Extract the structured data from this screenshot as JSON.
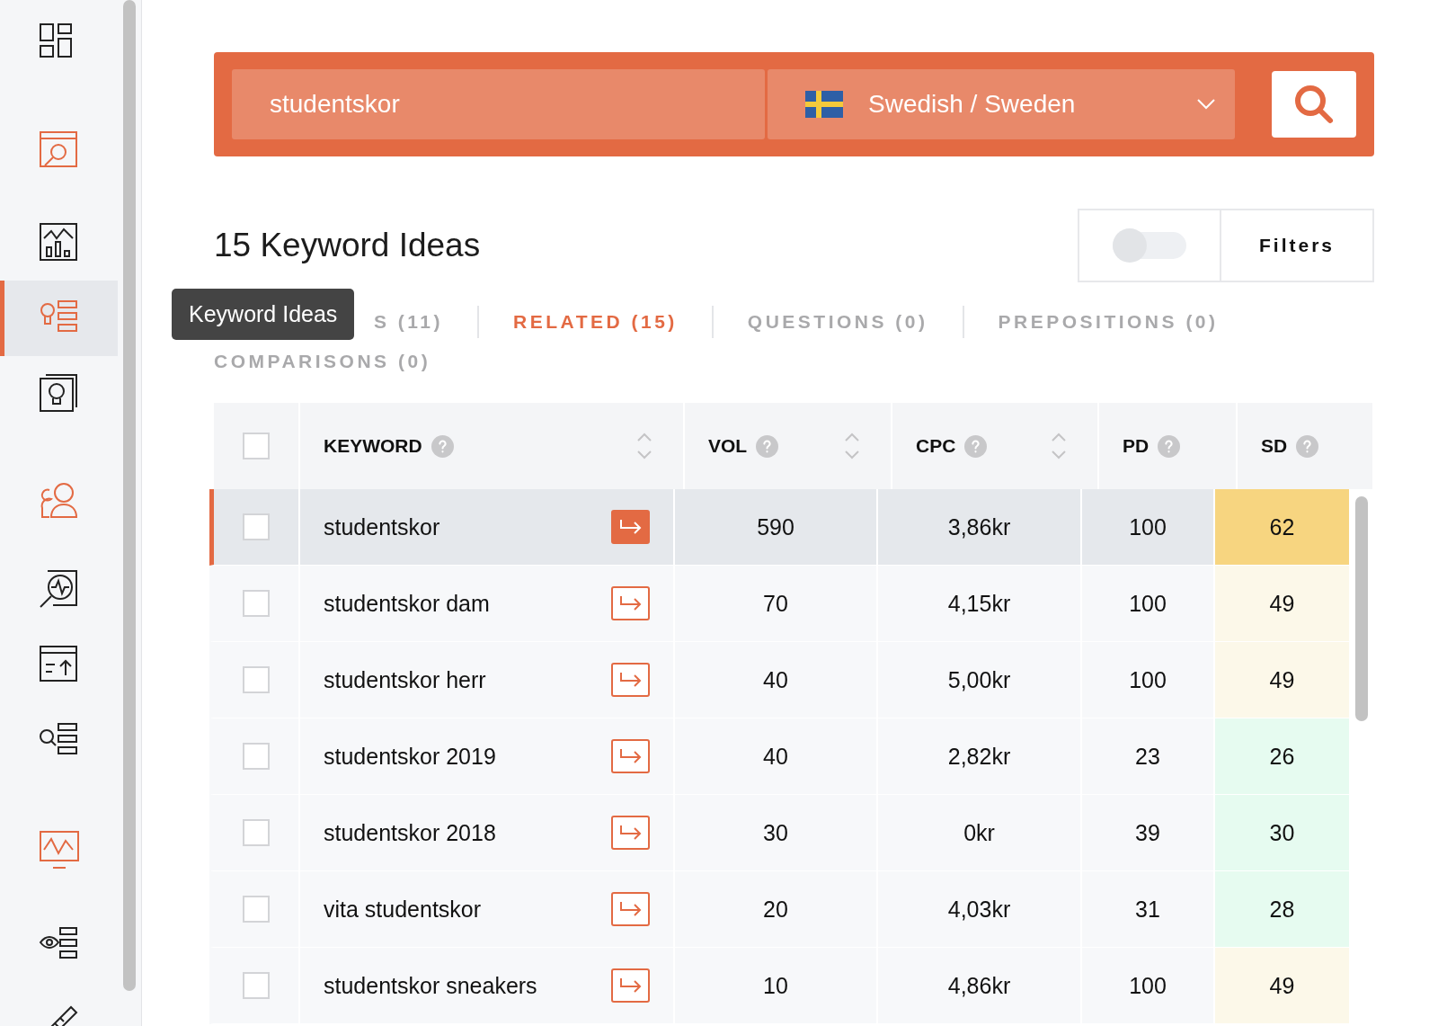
{
  "sidebar": {
    "items": [
      {
        "selected": false
      },
      {
        "selected": false
      },
      {
        "selected": false
      },
      {
        "selected": true
      },
      {
        "selected": false
      },
      {
        "selected": false
      },
      {
        "selected": false
      },
      {
        "selected": false
      },
      {
        "selected": false
      },
      {
        "selected": false
      },
      {
        "selected": false
      },
      {
        "selected": false
      }
    ],
    "tooltip": "Keyword Ideas"
  },
  "search": {
    "value": "studentskor",
    "language": "Swedish / Sweden"
  },
  "results_title": "15 Keyword Ideas",
  "filters": {
    "toggle_on": false,
    "label": "Filters"
  },
  "tabs": [
    {
      "label": "S (11)",
      "selected": false
    },
    {
      "label": "RELATED (15)",
      "selected": true
    },
    {
      "label": "QUESTIONS (0)",
      "selected": false
    },
    {
      "label": "PREPOSITIONS (0)",
      "selected": false
    },
    {
      "label": "COMPARISONS (0)",
      "selected": false
    }
  ],
  "table": {
    "select_all_checked": false,
    "columns": [
      {
        "label": "KEYWORD",
        "sortable": true
      },
      {
        "label": "VOL",
        "sortable": true
      },
      {
        "label": "CPC",
        "sortable": true
      },
      {
        "label": "PD",
        "sortable": false
      },
      {
        "label": "SD",
        "sortable": false
      }
    ],
    "rows": [
      {
        "keyword": "studentskor",
        "vol": "590",
        "cpc": "3,86kr",
        "pd": "100",
        "sd": "62",
        "color": "#f7d580",
        "selected": true,
        "checked": false
      },
      {
        "keyword": "studentskor dam",
        "vol": "70",
        "cpc": "4,15kr",
        "pd": "100",
        "sd": "49",
        "color": "#fcf8e9",
        "selected": false,
        "checked": false
      },
      {
        "keyword": "studentskor herr",
        "vol": "40",
        "cpc": "5,00kr",
        "pd": "100",
        "sd": "49",
        "color": "#fcf8e9",
        "selected": false,
        "checked": false
      },
      {
        "keyword": "studentskor 2019",
        "vol": "40",
        "cpc": "2,82kr",
        "pd": "23",
        "sd": "26",
        "color": "#e6fbf0",
        "selected": false,
        "checked": false
      },
      {
        "keyword": "studentskor 2018",
        "vol": "30",
        "cpc": "0kr",
        "pd": "39",
        "sd": "30",
        "color": "#e6fbf0",
        "selected": false,
        "checked": false
      },
      {
        "keyword": "vita studentskor",
        "vol": "20",
        "cpc": "4,03kr",
        "pd": "31",
        "sd": "28",
        "color": "#e6fbf0",
        "selected": false,
        "checked": false
      },
      {
        "keyword": "studentskor sneakers",
        "vol": "10",
        "cpc": "4,86kr",
        "pd": "100",
        "sd": "49",
        "color": "#fcf8e9",
        "selected": false,
        "checked": false
      }
    ]
  }
}
